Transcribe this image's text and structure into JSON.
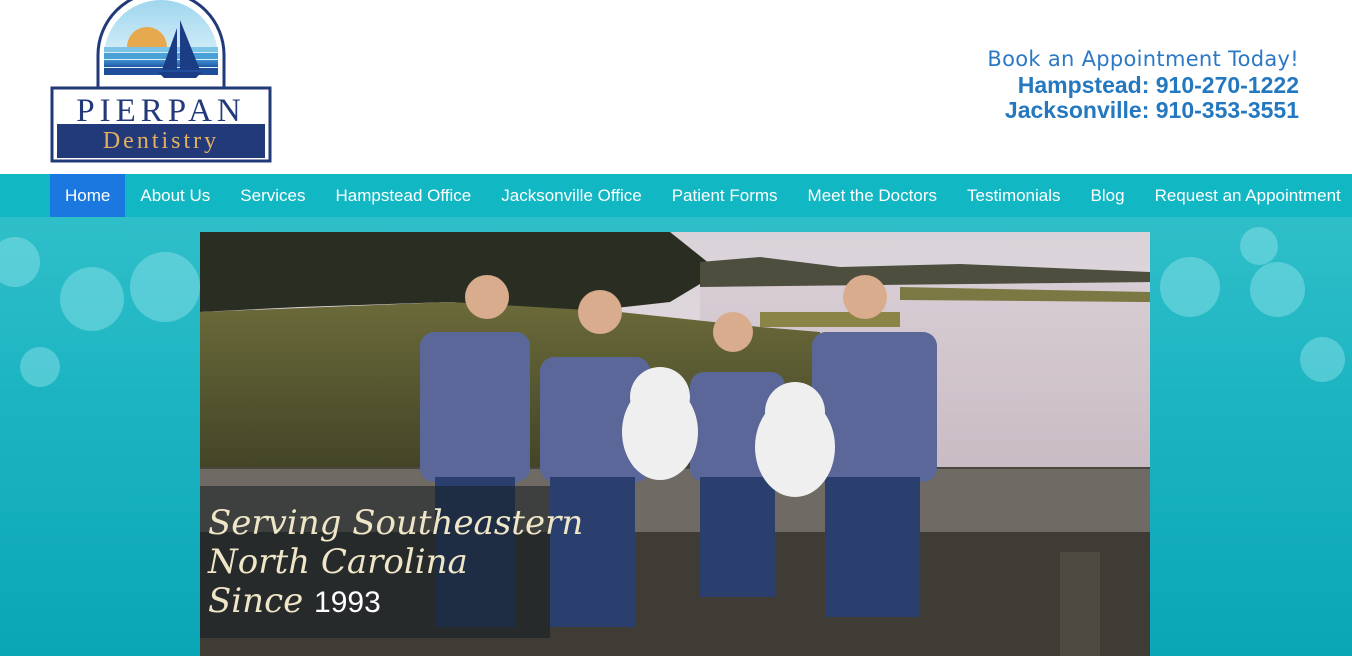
{
  "logo": {
    "top_text": "PIERPAN",
    "bottom_text": "Dentistry"
  },
  "contact": {
    "book_text": "Book an Appointment Today!",
    "phones": [
      {
        "label": "Hampstead:",
        "number": "910-270-1222"
      },
      {
        "label": "Jacksonville:",
        "number": "910-353-3551"
      }
    ]
  },
  "nav": {
    "items": [
      {
        "label": "Home",
        "active": true
      },
      {
        "label": "About Us"
      },
      {
        "label": "Services"
      },
      {
        "label": "Hampstead Office"
      },
      {
        "label": "Jacksonville Office"
      },
      {
        "label": "Patient Forms"
      },
      {
        "label": "Meet the Doctors"
      },
      {
        "label": "Testimonials"
      },
      {
        "label": "Blog"
      },
      {
        "label": "Request an Appointment"
      }
    ]
  },
  "hero": {
    "line1": "Serving Southeastern",
    "line2": "North Carolina",
    "since_word": "Since",
    "since_year": "1993"
  },
  "colors": {
    "nav_bg": "#12b7c4",
    "nav_active": "#1a78e0",
    "contact_blue": "#2478c0",
    "hero_bg": "#1ab3c1",
    "logo_navy": "#233a7a",
    "logo_gold": "#e3b15e"
  }
}
